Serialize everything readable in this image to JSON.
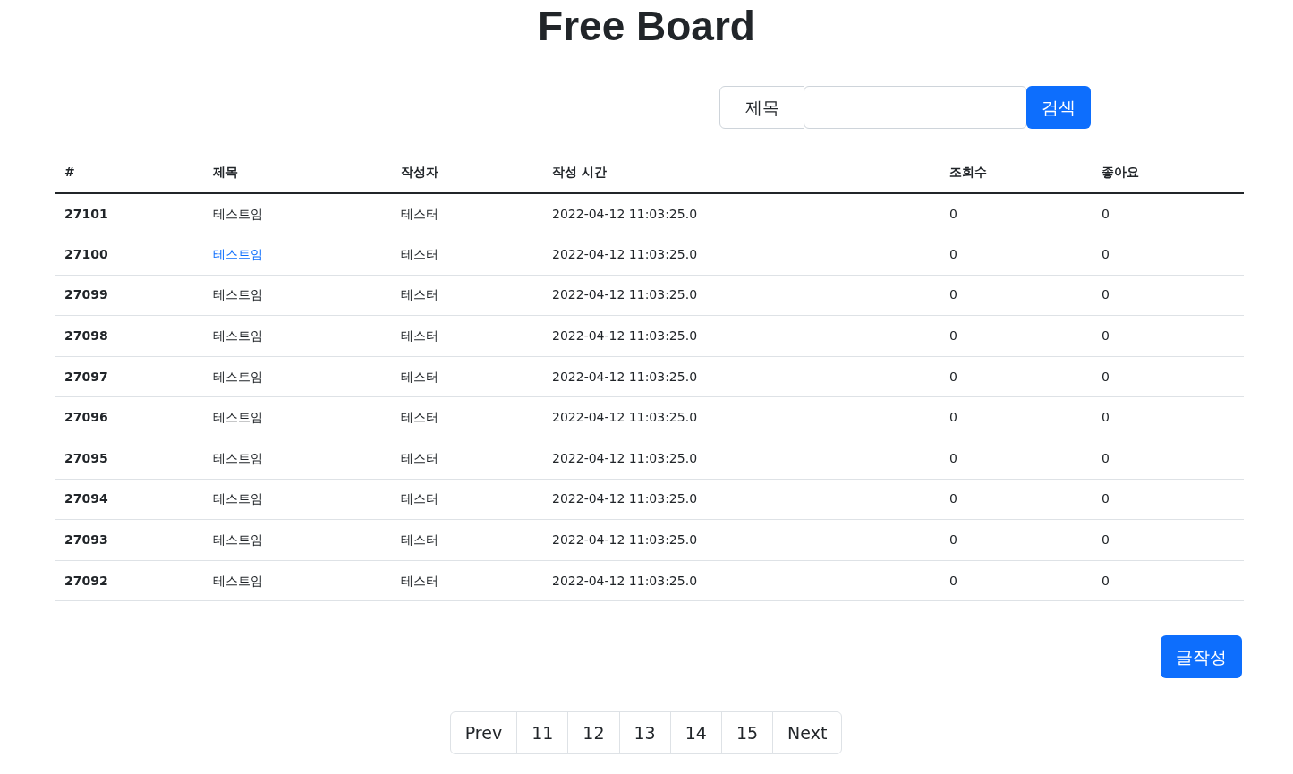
{
  "title": "Free Board",
  "search": {
    "field_label": "제목",
    "button": "검색"
  },
  "table": {
    "columns": [
      "#",
      "제목",
      "작성자",
      "작성 시간",
      "조회수",
      "좋아요"
    ],
    "rows": [
      {
        "id": "27101",
        "title": "테스트임",
        "author": "테스터",
        "time": "2022-04-12 11:03:25.0",
        "views": "0",
        "likes": "0",
        "hovered": false
      },
      {
        "id": "27100",
        "title": "테스트임",
        "author": "테스터",
        "time": "2022-04-12 11:03:25.0",
        "views": "0",
        "likes": "0",
        "hovered": true
      },
      {
        "id": "27099",
        "title": "테스트임",
        "author": "테스터",
        "time": "2022-04-12 11:03:25.0",
        "views": "0",
        "likes": "0",
        "hovered": false
      },
      {
        "id": "27098",
        "title": "테스트임",
        "author": "테스터",
        "time": "2022-04-12 11:03:25.0",
        "views": "0",
        "likes": "0",
        "hovered": false
      },
      {
        "id": "27097",
        "title": "테스트임",
        "author": "테스터",
        "time": "2022-04-12 11:03:25.0",
        "views": "0",
        "likes": "0",
        "hovered": false
      },
      {
        "id": "27096",
        "title": "테스트임",
        "author": "테스터",
        "time": "2022-04-12 11:03:25.0",
        "views": "0",
        "likes": "0",
        "hovered": false
      },
      {
        "id": "27095",
        "title": "테스트임",
        "author": "테스터",
        "time": "2022-04-12 11:03:25.0",
        "views": "0",
        "likes": "0",
        "hovered": false
      },
      {
        "id": "27094",
        "title": "테스트임",
        "author": "테스터",
        "time": "2022-04-12 11:03:25.0",
        "views": "0",
        "likes": "0",
        "hovered": false
      },
      {
        "id": "27093",
        "title": "테스트임",
        "author": "테스터",
        "time": "2022-04-12 11:03:25.0",
        "views": "0",
        "likes": "0",
        "hovered": false
      },
      {
        "id": "27092",
        "title": "테스트임",
        "author": "테스터",
        "time": "2022-04-12 11:03:25.0",
        "views": "0",
        "likes": "0",
        "hovered": false
      }
    ]
  },
  "write_button": "글작성",
  "pagination": [
    "Prev",
    "11",
    "12",
    "13",
    "14",
    "15",
    "Next"
  ]
}
